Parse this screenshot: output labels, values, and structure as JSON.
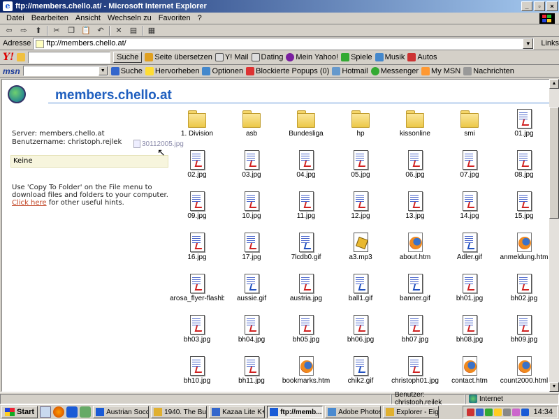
{
  "window": {
    "title": "ftp://members.chello.at/ - Microsoft Internet Explorer",
    "controls": [
      "_",
      "▫",
      "×"
    ]
  },
  "menu": [
    "Datei",
    "Bearbeiten",
    "Ansicht",
    "Wechseln zu",
    "Favoriten",
    "?"
  ],
  "address": {
    "label": "Adresse",
    "value": "ftp://members.chello.at/",
    "links_label": "Links"
  },
  "yahoo_bar": {
    "logo": "Y!",
    "search_label": "Suche",
    "items": [
      "Seite übersetzen",
      "Y! Mail",
      "Dating",
      "Mein Yahoo!",
      "Spiele",
      "Musik",
      "Autos"
    ]
  },
  "msn_bar": {
    "logo": "msn",
    "items": [
      "Suche",
      "Hervorheben",
      "Optionen",
      "Blockierte Popups (0)",
      "Hotmail",
      "Messenger",
      "My MSN",
      "Nachrichten"
    ]
  },
  "ftp": {
    "title": "members.chello.at",
    "server_line": "Server: members.chello.at",
    "user_line": "Benutzername: christoph.rejlek",
    "selection": "Keine",
    "hint_before": "Use 'Copy To Folder' on the File menu to download files and folders to your computer.",
    "hint_link": "Click here",
    "hint_after": " for other useful hints."
  },
  "files": [
    {
      "name": "1. Division",
      "type": "folder"
    },
    {
      "name": "asb",
      "type": "folder"
    },
    {
      "name": "Bundesliga",
      "type": "folder"
    },
    {
      "name": "hp",
      "type": "folder"
    },
    {
      "name": "kissonline",
      "type": "folder"
    },
    {
      "name": "smi",
      "type": "folder"
    },
    {
      "name": "01.jpg",
      "type": "jpg"
    },
    {
      "name": "02.jpg",
      "type": "jpg"
    },
    {
      "name": "03.jpg",
      "type": "jpg"
    },
    {
      "name": "04.jpg",
      "type": "jpg"
    },
    {
      "name": "05.jpg",
      "type": "jpg"
    },
    {
      "name": "06.jpg",
      "type": "jpg"
    },
    {
      "name": "07.jpg",
      "type": "jpg"
    },
    {
      "name": "08.jpg",
      "type": "jpg"
    },
    {
      "name": "09.jpg",
      "type": "jpg"
    },
    {
      "name": "10.jpg",
      "type": "jpg"
    },
    {
      "name": "11.jpg",
      "type": "jpg"
    },
    {
      "name": "12.jpg",
      "type": "jpg"
    },
    {
      "name": "13.jpg",
      "type": "jpg"
    },
    {
      "name": "14.jpg",
      "type": "jpg"
    },
    {
      "name": "15.jpg",
      "type": "jpg"
    },
    {
      "name": "16.jpg",
      "type": "jpg"
    },
    {
      "name": "17.jpg",
      "type": "jpg"
    },
    {
      "name": "7lcdb0.gif",
      "type": "gif"
    },
    {
      "name": "a3.mp3",
      "type": "mp3"
    },
    {
      "name": "about.htm",
      "type": "fx"
    },
    {
      "name": "Adler.gif",
      "type": "gif"
    },
    {
      "name": "anmeldung.htm",
      "type": "fx"
    },
    {
      "name": "arosa_flyer-flashb...",
      "type": "jpg"
    },
    {
      "name": "aussie.gif",
      "type": "gif"
    },
    {
      "name": "austria.jpg",
      "type": "jpg"
    },
    {
      "name": "ball1.gif",
      "type": "gif"
    },
    {
      "name": "banner.gif",
      "type": "gif"
    },
    {
      "name": "bh01.jpg",
      "type": "jpg"
    },
    {
      "name": "bh02.jpg",
      "type": "jpg"
    },
    {
      "name": "bh03.jpg",
      "type": "jpg"
    },
    {
      "name": "bh04.jpg",
      "type": "jpg"
    },
    {
      "name": "bh05.jpg",
      "type": "jpg"
    },
    {
      "name": "bh06.jpg",
      "type": "jpg"
    },
    {
      "name": "bh07.jpg",
      "type": "jpg"
    },
    {
      "name": "bh08.jpg",
      "type": "jpg"
    },
    {
      "name": "bh09.jpg",
      "type": "jpg"
    },
    {
      "name": "bh10.jpg",
      "type": "jpg"
    },
    {
      "name": "bh11.jpg",
      "type": "jpg"
    },
    {
      "name": "bookmarks.htm",
      "type": "fx"
    },
    {
      "name": "chik2.gif",
      "type": "gif"
    },
    {
      "name": "christoph01.jpg",
      "type": "jpg"
    },
    {
      "name": "contact.htm",
      "type": "fx"
    },
    {
      "name": "count2000.html",
      "type": "fx"
    }
  ],
  "drag_ghost": "30112005.jpg",
  "status": {
    "user": "Benutzer: christoph.rejlek",
    "zone": "Internet"
  },
  "taskbar": {
    "start": "Start",
    "tasks": [
      {
        "label": "Austrian Socc...",
        "active": false
      },
      {
        "label": "1940. The Bu...",
        "active": false
      },
      {
        "label": "Kazaa Lite K+...",
        "active": false
      },
      {
        "label": "ftp://memb...",
        "active": true
      },
      {
        "label": "Adobe Photos...",
        "active": false
      },
      {
        "label": "Explorer - Eige...",
        "active": false
      }
    ],
    "clock": "14:34"
  }
}
